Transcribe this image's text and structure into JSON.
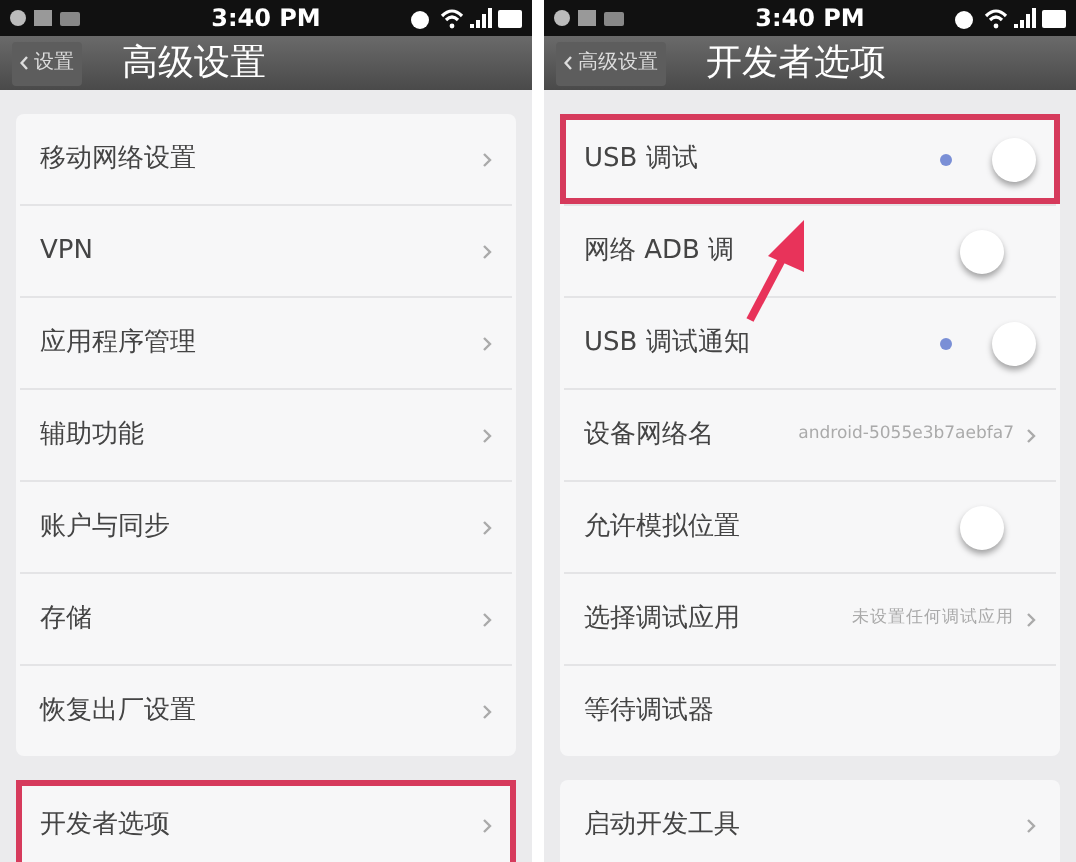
{
  "screens": [
    {
      "status_bar": {
        "time": "3:40 PM"
      },
      "back_button": "设置",
      "title": "高级设置",
      "groups": [
        [
          {
            "kind": "link",
            "label": "移动网络设置",
            "highlighted": false
          },
          {
            "kind": "link",
            "label": "VPN",
            "highlighted": false
          },
          {
            "kind": "link",
            "label": "应用程序管理",
            "highlighted": false
          },
          {
            "kind": "link",
            "label": "辅助功能",
            "highlighted": false
          },
          {
            "kind": "link",
            "label": "账户与同步",
            "highlighted": false
          },
          {
            "kind": "link",
            "label": "存储",
            "highlighted": false
          },
          {
            "kind": "link",
            "label": "恢复出厂设置",
            "highlighted": false
          }
        ],
        [
          {
            "kind": "link",
            "label": "开发者选项",
            "highlighted": true
          }
        ]
      ]
    },
    {
      "status_bar": {
        "time": "3:40 PM"
      },
      "back_button": "高级设置",
      "title": "开发者选项",
      "groups": [
        [
          {
            "kind": "toggle",
            "label": "USB 调试",
            "on": true,
            "highlighted": true
          },
          {
            "kind": "toggle",
            "label": "网络 ADB 调",
            "on": false,
            "highlighted": false
          },
          {
            "kind": "toggle",
            "label": "USB 调试通知",
            "on": true,
            "highlighted": false
          },
          {
            "kind": "value",
            "label": "设备网络名",
            "value": "android-5055e3b7aebfa7",
            "highlighted": false
          },
          {
            "kind": "toggle",
            "label": "允许模拟位置",
            "on": false,
            "highlighted": false
          },
          {
            "kind": "value",
            "label": "选择调试应用",
            "value": "未设置任何调试应用",
            "highlighted": false
          },
          {
            "kind": "plain",
            "label": "等待调试器",
            "highlighted": false
          }
        ],
        [
          {
            "kind": "link",
            "label": "启动开发工具",
            "highlighted": false
          }
        ]
      ]
    }
  ]
}
